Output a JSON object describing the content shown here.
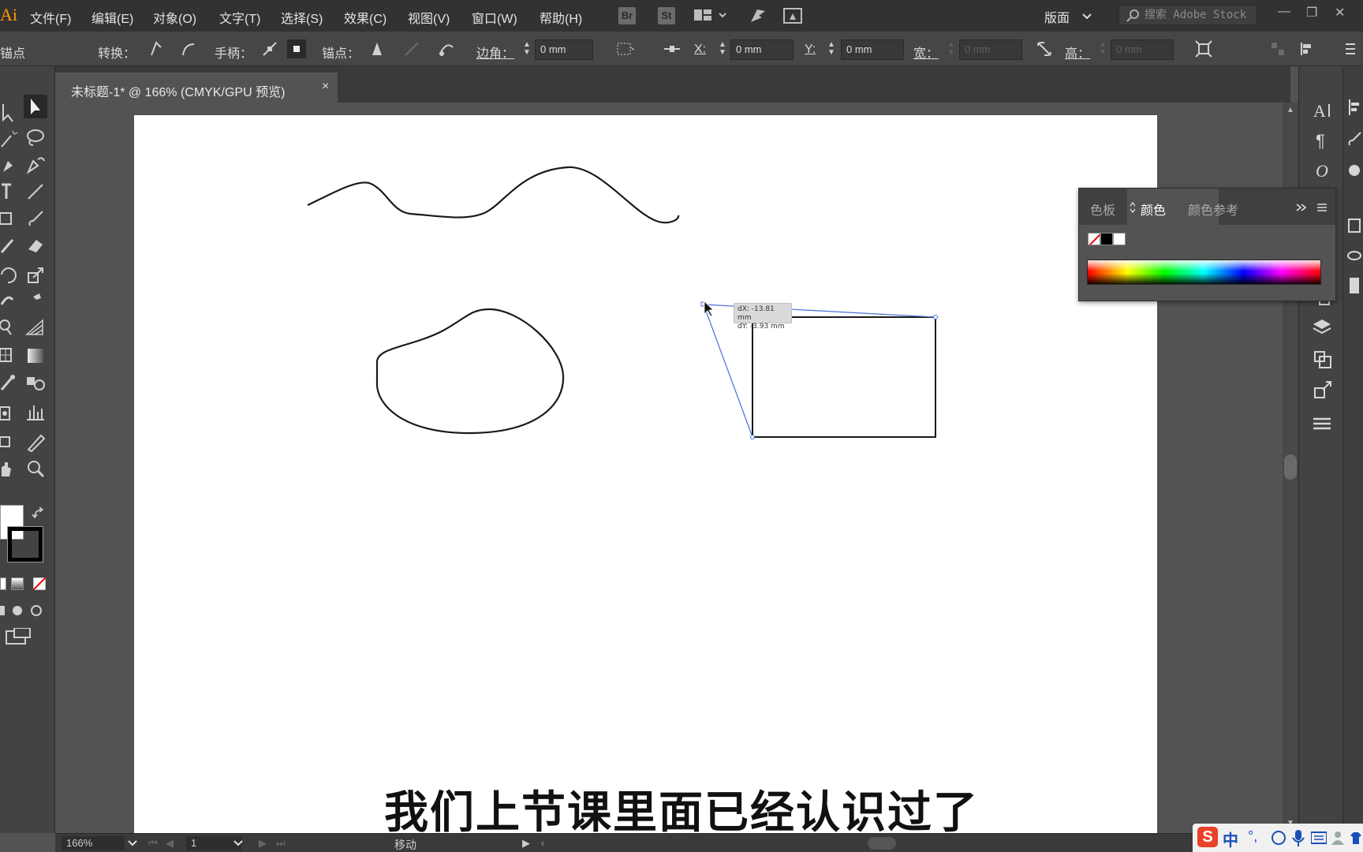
{
  "app": {
    "logo": "Ai"
  },
  "menu": {
    "items": [
      "文件(F)",
      "编辑(E)",
      "对象(O)",
      "文字(T)",
      "选择(S)",
      "效果(C)",
      "视图(V)",
      "窗口(W)",
      "帮助(H)"
    ],
    "bridge_badge": "Br",
    "stock_badge": "St",
    "workspace": "版面",
    "search_placeholder": "搜索 Adobe Stock"
  },
  "control_bar": {
    "anchor_label": "锚点",
    "convert_label": "转换：",
    "handle_label": "手柄：",
    "anchor_point_label": "锚点：",
    "corner_label": "边角：",
    "corner_value": "0 mm",
    "x_label": "X:",
    "x_value": "0 mm",
    "y_label": "Y:",
    "y_value": "0 mm",
    "width_label": "宽：",
    "width_value": "0 mm",
    "height_label": "高：",
    "height_value": "0 mm"
  },
  "document": {
    "tab_title": "未标题-1* @ 166% (CMYK/GPU 预览)",
    "close_glyph": "×"
  },
  "canvas": {
    "measure_tooltip": {
      "dx": "dX: -13.81 mm",
      "dy": "dY: -3.93 mm"
    }
  },
  "color_panel": {
    "tabs": [
      "色板",
      "颜色",
      "颜色参考"
    ],
    "active_tab": "颜色",
    "swatches": [
      "none",
      "#000000",
      "#ffffff"
    ]
  },
  "status_bar": {
    "zoom": "166%",
    "page": "1",
    "status": "移动"
  },
  "subtitle": "我们上节课里面已经认识过了",
  "ime": {
    "logo": "S",
    "lang": "中"
  },
  "colors": {
    "ui_dark": "#323232",
    "ui_mid": "#434343",
    "pasteboard": "#535353",
    "artboard": "#ffffff",
    "selection_blue": "#4a6fd8"
  }
}
